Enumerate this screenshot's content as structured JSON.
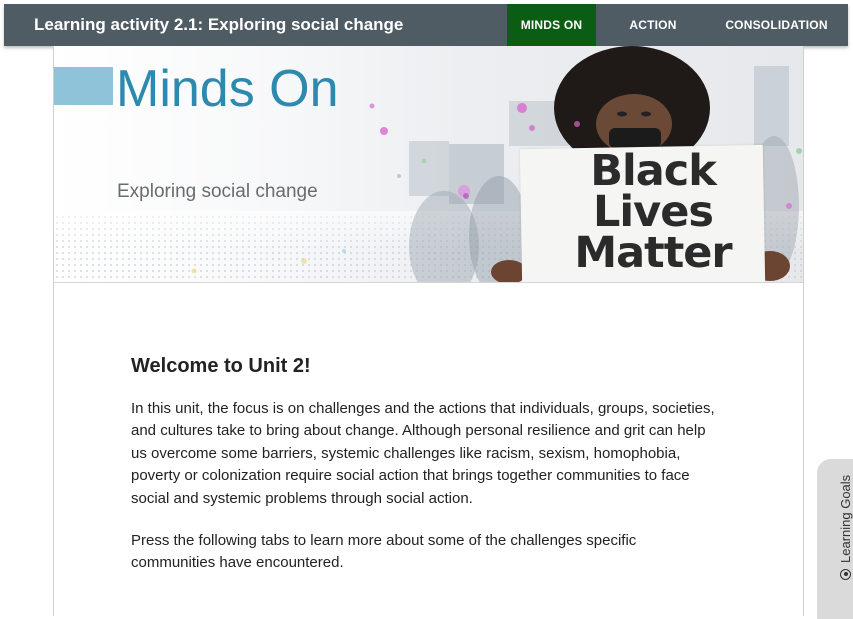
{
  "topbar": {
    "title": "Learning activity 2.1: Exploring social change",
    "tabs": [
      {
        "label": "MINDS ON",
        "active": true
      },
      {
        "label": "ACTION",
        "active": false
      },
      {
        "label": "CONSOLIDATION",
        "active": false
      }
    ],
    "active_color": "#0b5d14",
    "bar_color": "#4f5c64"
  },
  "banner": {
    "heading": "Minds On",
    "subtitle": "Exploring social change",
    "sign_lines": [
      "Black",
      "Lives",
      "Matter"
    ],
    "accent_color": "#8ec3d9",
    "heading_color": "#2d89ad"
  },
  "article": {
    "heading": "Welcome to Unit 2!",
    "paragraphs": [
      "In this unit, the focus is on challenges and the actions that individuals, groups, societies, and cultures take to bring about change. Although personal resilience and grit can help us overcome some barriers, systemic challenges like racism, sexism, homophobia, poverty or colonization require social action that brings together communities to face social and systemic problems through social action.",
      "Press the following tabs to learn more about some of the challenges specific communities have encountered."
    ]
  },
  "side_tab": {
    "label": "Learning Goals",
    "icon": "radio-icon"
  }
}
